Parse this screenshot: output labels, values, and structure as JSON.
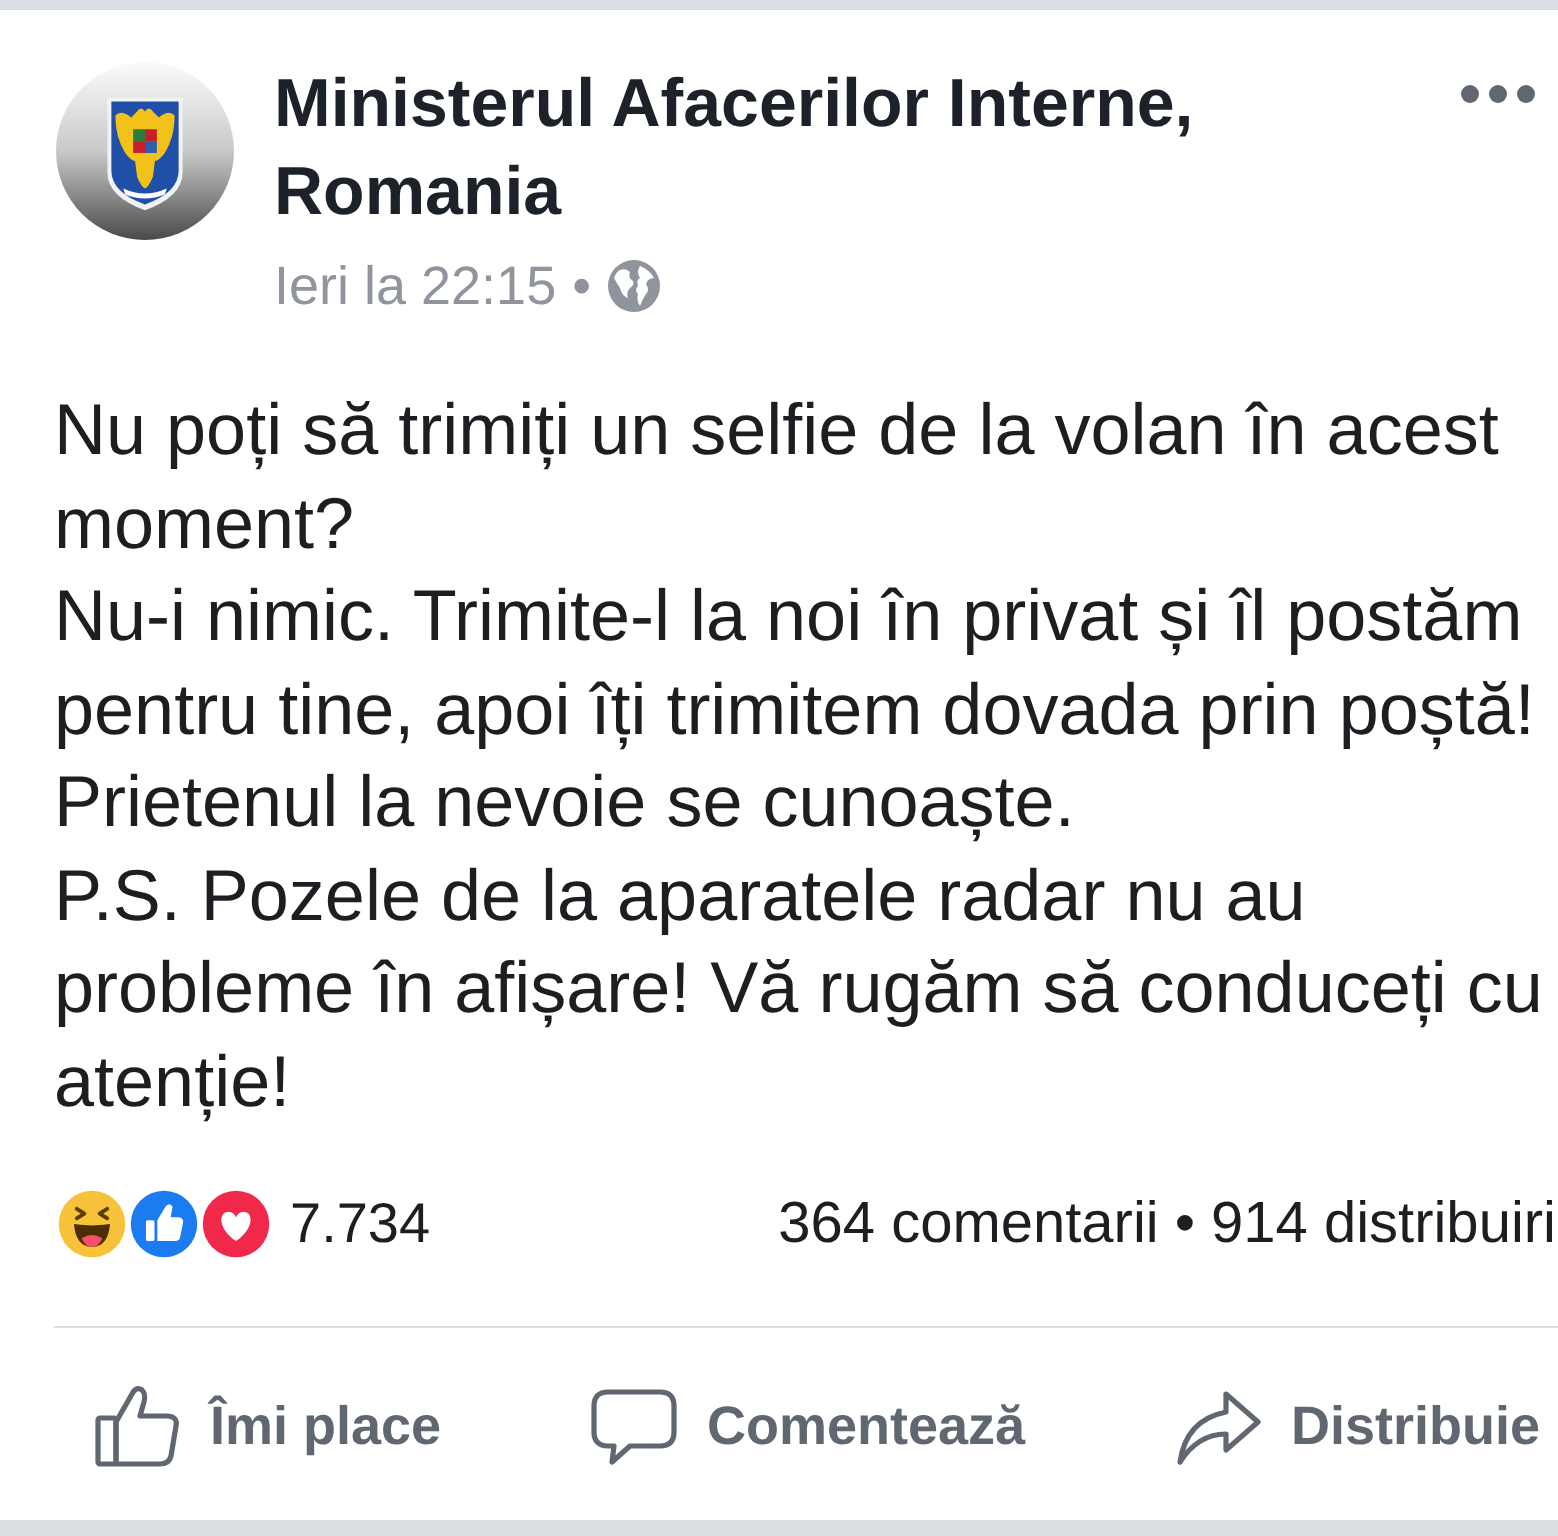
{
  "post": {
    "author": "Ministerul Afacerilor Interne, Romania",
    "time": "Ieri la 22:15",
    "time_separator": "•",
    "paragraphs": [
      "Nu poți să trimiți un selfie de la volan în acest moment?",
      "Nu-i nimic. Trimite-l la noi în privat și îl postăm pentru tine, apoi îți trimitem dovada prin poștă!",
      "Prietenul la nevoie se cunoaște.",
      "P.S. Pozele de la aparatele radar nu au probleme în afișare! Vă rugăm să conduceți cu atenție!"
    ]
  },
  "reactions": {
    "types": [
      {
        "kind": "haha"
      },
      {
        "kind": "like"
      },
      {
        "kind": "love"
      }
    ],
    "count": "7.734"
  },
  "stats": [
    "364 comentarii",
    "914 distribuiri"
  ],
  "stats_separator": "•",
  "actions": [
    {
      "kind": "like",
      "label": "Îmi place"
    },
    {
      "kind": "comment",
      "label": "Comentează"
    },
    {
      "kind": "share",
      "label": "Distribuie"
    }
  ]
}
